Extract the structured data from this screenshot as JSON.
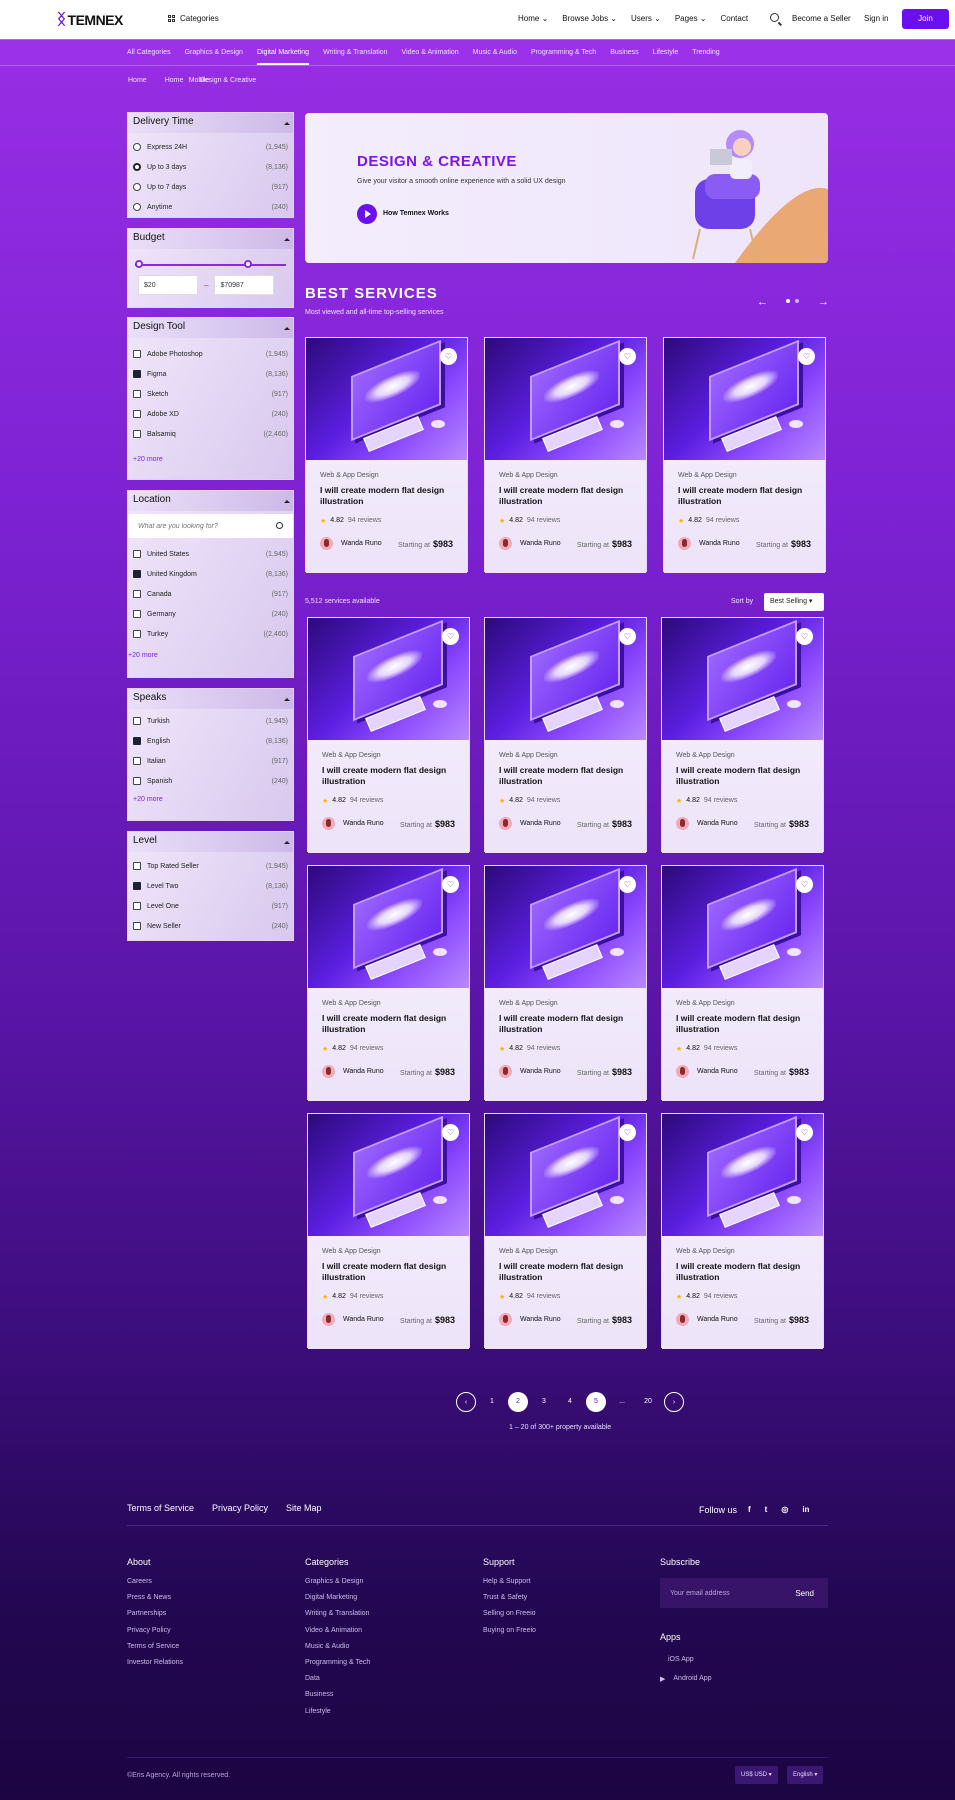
{
  "header": {
    "logo": "TEMNEX",
    "categories": "Categories",
    "nav": [
      "Home",
      "Browse Jobs",
      "Users",
      "Pages",
      "Contact"
    ],
    "become_seller": "Become a Seller",
    "signin": "Sign in",
    "join": "Join"
  },
  "catbar": [
    "All Categories",
    "Graphics & Design",
    "Digital Marketing",
    "Writing & Translation",
    "Video & Animation",
    "Music & Audio",
    "Programming & Tech",
    "Business",
    "Lifestyle",
    "Trending"
  ],
  "breadcrumb": [
    "Home",
    "Home",
    "Mobile",
    "Design & Creative"
  ],
  "filters": {
    "delivery": {
      "title": "Delivery Time",
      "items": [
        {
          "label": "Express 24H",
          "count": "(1,945)"
        },
        {
          "label": "Up to 3 days",
          "count": "(8,136)"
        },
        {
          "label": "Up to 7 days",
          "count": "(917)"
        },
        {
          "label": "Anytime",
          "count": "(240)"
        }
      ]
    },
    "budget": {
      "title": "Budget",
      "min": "$20",
      "max": "$70987"
    },
    "tool": {
      "title": "Design Tool",
      "items": [
        {
          "label": "Adobe Photoshop",
          "count": "(1,945)"
        },
        {
          "label": "Figma",
          "count": "(8,136)"
        },
        {
          "label": "Sketch",
          "count": "(917)"
        },
        {
          "label": "Adobe XD",
          "count": "(240)"
        },
        {
          "label": "Balsamiq",
          "count": "((2,460)"
        }
      ],
      "more": "+20 more"
    },
    "location": {
      "title": "Location",
      "placeholder": "What are you looking for?",
      "items": [
        {
          "label": "United States",
          "count": "(1,945)"
        },
        {
          "label": "United Kingdom",
          "count": "(8,136)"
        },
        {
          "label": "Canada",
          "count": "(917)"
        },
        {
          "label": "Germany",
          "count": "(240)"
        },
        {
          "label": "Turkey",
          "count": "((2,460)"
        }
      ],
      "more": "+20 more"
    },
    "speaks": {
      "title": "Speaks",
      "items": [
        {
          "label": "Turkish",
          "count": "(1,945)"
        },
        {
          "label": "English",
          "count": "(8,136)"
        },
        {
          "label": "Italian",
          "count": "(917)"
        },
        {
          "label": "Spanish",
          "count": "(240)"
        }
      ],
      "more": "+20 more"
    },
    "level": {
      "title": "Level",
      "items": [
        {
          "label": "Top Rated Seller",
          "count": "(1,945)"
        },
        {
          "label": "Level Two",
          "count": "(8,136)"
        },
        {
          "label": "Level One",
          "count": "(917)"
        },
        {
          "label": "New Seller",
          "count": "(240)"
        }
      ]
    }
  },
  "hero": {
    "title": "DESIGN & CREATIVE",
    "subtitle": "Give your visitor a smooth online experience with a solid UX design",
    "play_label": "How Temnex Works"
  },
  "best": {
    "title": "BEST SERVICES",
    "subtitle": "Most viewed and all-time top-selling services"
  },
  "card": {
    "category": "Web & App Design",
    "title": "I will create modern flat design illustration",
    "rating": "4.82",
    "reviews": "94 reviews",
    "seller": "Wanda Runo",
    "starting": "Starting at",
    "price": "$983"
  },
  "listing": {
    "count": "5,512 services available",
    "sort_label": "Sort by",
    "sort_value": "Best Selling"
  },
  "pagination": {
    "pages": [
      "1",
      "2",
      "3",
      "4",
      "5",
      "...",
      "20"
    ],
    "prev": "‹",
    "next": "›",
    "info": "1 – 20 of 300+ property available"
  },
  "footer": {
    "links": [
      "Terms of Service",
      "Privacy Policy",
      "Site Map"
    ],
    "follow": "Follow us",
    "social": [
      "f",
      "t",
      "◎",
      "in"
    ],
    "about": {
      "title": "About",
      "items": [
        "Careers",
        "Press & News",
        "Partnerships",
        "Privacy Policy",
        "Terms of Service",
        "Investor Relations"
      ]
    },
    "categories": {
      "title": "Categories",
      "items": [
        "Graphics & Design",
        "Digital Marketing",
        "Writing & Translation",
        "Video & Animation",
        "Music & Audio",
        "Programming & Tech",
        "Data",
        "Business",
        "Lifestyle"
      ]
    },
    "support": {
      "title": "Support",
      "items": [
        "Help & Support",
        "Trust & Safety",
        "Selling on Freeio",
        "Buying on Freeio"
      ]
    },
    "subscribe": {
      "title": "Subscribe",
      "placeholder": "Your email address",
      "send": "Send"
    },
    "apps": {
      "title": "Apps",
      "ios": "iOS App",
      "android": "Android App"
    },
    "copyright": "©Eris Agency. All rights reserved.",
    "currency": "US$ USD ▾",
    "language": "English ▾"
  },
  "colors": {
    "accent": "#6a0ff0",
    "purple": "#9b32ea"
  }
}
